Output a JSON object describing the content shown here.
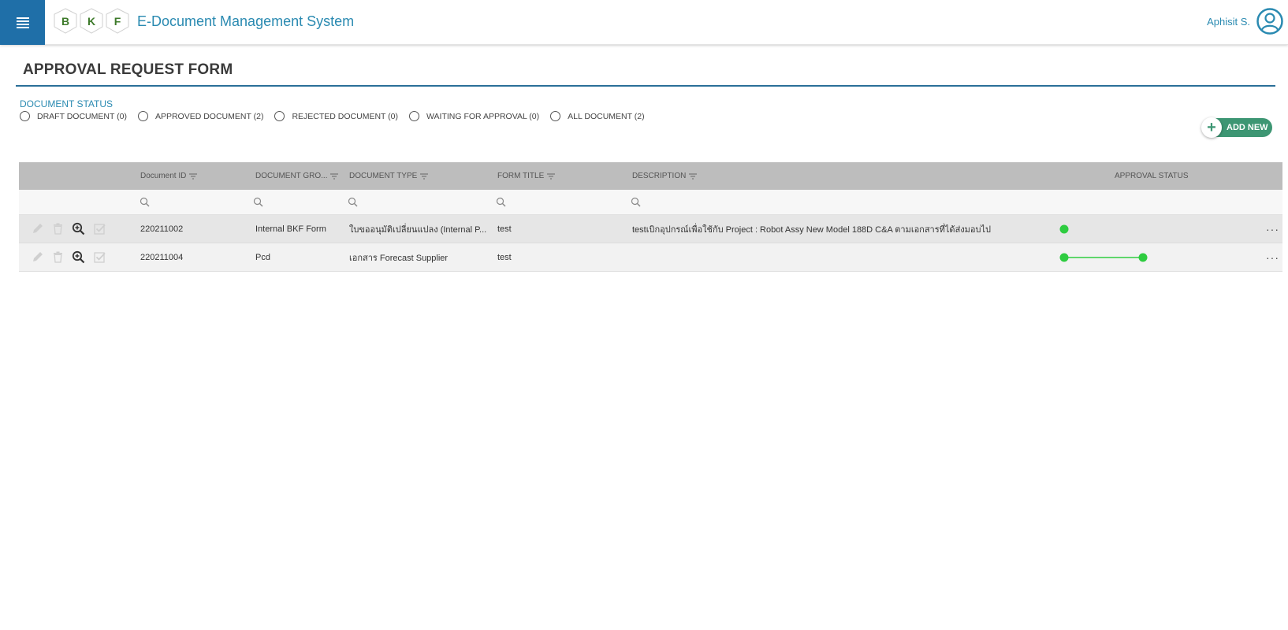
{
  "header": {
    "logo_letters": [
      "B",
      "K",
      "F"
    ],
    "app_title": "E-Document Management System",
    "user_name": "Aphisit S.",
    "brand_color": "#1f6fa8",
    "logo_color": "#3d7a2a"
  },
  "page": {
    "title": "APPROVAL REQUEST FORM",
    "status_label": "DOCUMENT STATUS",
    "statuses": [
      {
        "label": "DRAFT DOCUMENT (0)",
        "selected": false
      },
      {
        "label": "APPROVED DOCUMENT (2)",
        "selected": false
      },
      {
        "label": "REJECTED DOCUMENT (0)",
        "selected": false
      },
      {
        "label": "WAITING FOR APPROVAL (0)",
        "selected": false
      },
      {
        "label": "ALL DOCUMENT (2)",
        "selected": false
      }
    ],
    "add_new_label": "ADD NEW"
  },
  "grid": {
    "columns": [
      "Document ID",
      "DOCUMENT GRO...",
      "DOCUMENT TYPE",
      "FORM TITLE",
      "DESCRIPTION",
      "APPROVAL STATUS"
    ],
    "rows": [
      {
        "document_id": "220211002",
        "document_group": "Internal BKF Form",
        "document_type": "ใบขออนุมัติเปลี่ยนแปลง (Internal P...",
        "form_title": "test",
        "description": "testเบิกอุปกรณ์เพื่อใช้กับ Project : Robot Assy New Model 188D C&A ตามเอกสารที่ได้ส่งมอบไป",
        "approval_steps_completed": 1,
        "more_label": "···"
      },
      {
        "document_id": "220211004",
        "document_group": "Pcd",
        "document_type": "เอกสาร Forecast Supplier",
        "form_title": "test",
        "description": "",
        "approval_steps_completed": 2,
        "more_label": "···"
      }
    ],
    "status_color": "#2ecc40"
  },
  "icons": [
    "menu-icon",
    "user-avatar-icon",
    "filter-icon",
    "search-icon",
    "edit-icon",
    "delete-icon",
    "zoom-in-icon",
    "approve-check-icon",
    "more-icon",
    "plus-icon"
  ]
}
